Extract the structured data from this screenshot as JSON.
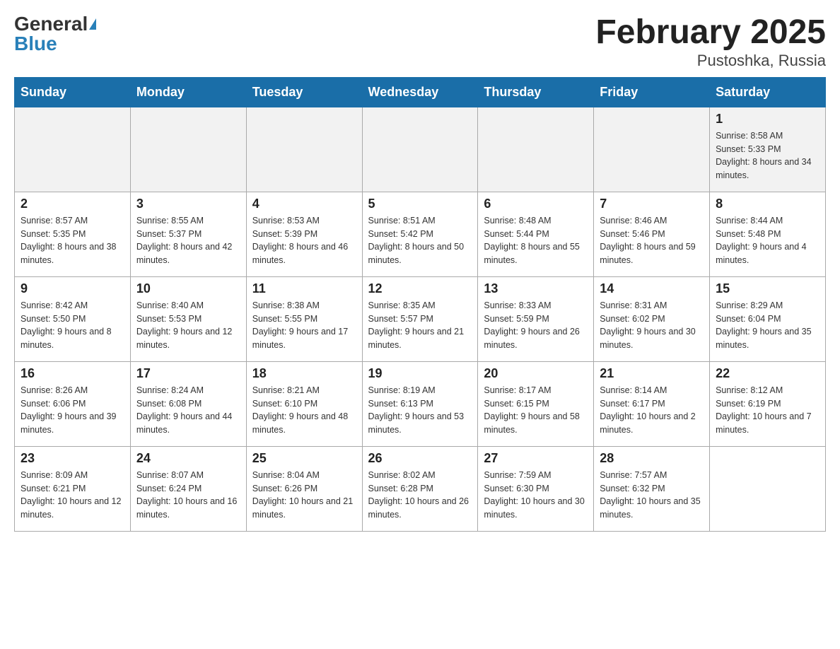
{
  "header": {
    "logo_general": "General",
    "logo_blue": "Blue",
    "month_title": "February 2025",
    "location": "Pustoshka, Russia"
  },
  "days_of_week": [
    "Sunday",
    "Monday",
    "Tuesday",
    "Wednesday",
    "Thursday",
    "Friday",
    "Saturday"
  ],
  "weeks": [
    {
      "cells": [
        {
          "day": "",
          "info": ""
        },
        {
          "day": "",
          "info": ""
        },
        {
          "day": "",
          "info": ""
        },
        {
          "day": "",
          "info": ""
        },
        {
          "day": "",
          "info": ""
        },
        {
          "day": "",
          "info": ""
        },
        {
          "day": "1",
          "info": "Sunrise: 8:58 AM\nSunset: 5:33 PM\nDaylight: 8 hours and 34 minutes."
        }
      ]
    },
    {
      "cells": [
        {
          "day": "2",
          "info": "Sunrise: 8:57 AM\nSunset: 5:35 PM\nDaylight: 8 hours and 38 minutes."
        },
        {
          "day": "3",
          "info": "Sunrise: 8:55 AM\nSunset: 5:37 PM\nDaylight: 8 hours and 42 minutes."
        },
        {
          "day": "4",
          "info": "Sunrise: 8:53 AM\nSunset: 5:39 PM\nDaylight: 8 hours and 46 minutes."
        },
        {
          "day": "5",
          "info": "Sunrise: 8:51 AM\nSunset: 5:42 PM\nDaylight: 8 hours and 50 minutes."
        },
        {
          "day": "6",
          "info": "Sunrise: 8:48 AM\nSunset: 5:44 PM\nDaylight: 8 hours and 55 minutes."
        },
        {
          "day": "7",
          "info": "Sunrise: 8:46 AM\nSunset: 5:46 PM\nDaylight: 8 hours and 59 minutes."
        },
        {
          "day": "8",
          "info": "Sunrise: 8:44 AM\nSunset: 5:48 PM\nDaylight: 9 hours and 4 minutes."
        }
      ]
    },
    {
      "cells": [
        {
          "day": "9",
          "info": "Sunrise: 8:42 AM\nSunset: 5:50 PM\nDaylight: 9 hours and 8 minutes."
        },
        {
          "day": "10",
          "info": "Sunrise: 8:40 AM\nSunset: 5:53 PM\nDaylight: 9 hours and 12 minutes."
        },
        {
          "day": "11",
          "info": "Sunrise: 8:38 AM\nSunset: 5:55 PM\nDaylight: 9 hours and 17 minutes."
        },
        {
          "day": "12",
          "info": "Sunrise: 8:35 AM\nSunset: 5:57 PM\nDaylight: 9 hours and 21 minutes."
        },
        {
          "day": "13",
          "info": "Sunrise: 8:33 AM\nSunset: 5:59 PM\nDaylight: 9 hours and 26 minutes."
        },
        {
          "day": "14",
          "info": "Sunrise: 8:31 AM\nSunset: 6:02 PM\nDaylight: 9 hours and 30 minutes."
        },
        {
          "day": "15",
          "info": "Sunrise: 8:29 AM\nSunset: 6:04 PM\nDaylight: 9 hours and 35 minutes."
        }
      ]
    },
    {
      "cells": [
        {
          "day": "16",
          "info": "Sunrise: 8:26 AM\nSunset: 6:06 PM\nDaylight: 9 hours and 39 minutes."
        },
        {
          "day": "17",
          "info": "Sunrise: 8:24 AM\nSunset: 6:08 PM\nDaylight: 9 hours and 44 minutes."
        },
        {
          "day": "18",
          "info": "Sunrise: 8:21 AM\nSunset: 6:10 PM\nDaylight: 9 hours and 48 minutes."
        },
        {
          "day": "19",
          "info": "Sunrise: 8:19 AM\nSunset: 6:13 PM\nDaylight: 9 hours and 53 minutes."
        },
        {
          "day": "20",
          "info": "Sunrise: 8:17 AM\nSunset: 6:15 PM\nDaylight: 9 hours and 58 minutes."
        },
        {
          "day": "21",
          "info": "Sunrise: 8:14 AM\nSunset: 6:17 PM\nDaylight: 10 hours and 2 minutes."
        },
        {
          "day": "22",
          "info": "Sunrise: 8:12 AM\nSunset: 6:19 PM\nDaylight: 10 hours and 7 minutes."
        }
      ]
    },
    {
      "cells": [
        {
          "day": "23",
          "info": "Sunrise: 8:09 AM\nSunset: 6:21 PM\nDaylight: 10 hours and 12 minutes."
        },
        {
          "day": "24",
          "info": "Sunrise: 8:07 AM\nSunset: 6:24 PM\nDaylight: 10 hours and 16 minutes."
        },
        {
          "day": "25",
          "info": "Sunrise: 8:04 AM\nSunset: 6:26 PM\nDaylight: 10 hours and 21 minutes."
        },
        {
          "day": "26",
          "info": "Sunrise: 8:02 AM\nSunset: 6:28 PM\nDaylight: 10 hours and 26 minutes."
        },
        {
          "day": "27",
          "info": "Sunrise: 7:59 AM\nSunset: 6:30 PM\nDaylight: 10 hours and 30 minutes."
        },
        {
          "day": "28",
          "info": "Sunrise: 7:57 AM\nSunset: 6:32 PM\nDaylight: 10 hours and 35 minutes."
        },
        {
          "day": "",
          "info": ""
        }
      ]
    }
  ]
}
